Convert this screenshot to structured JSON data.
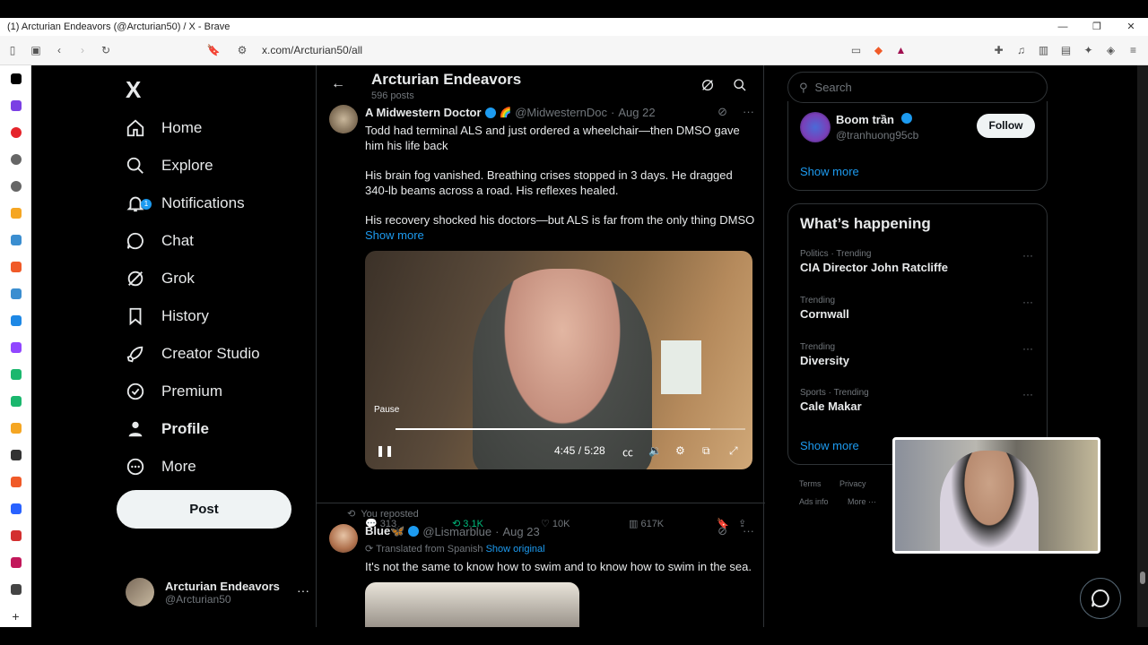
{
  "window": {
    "title": "(1) Arcturian Endeavors (@Arcturian50) / X - Brave",
    "controls": [
      "—",
      "❐",
      "✕"
    ]
  },
  "address": {
    "url": "x.com/Arcturian50/all"
  },
  "nav": {
    "logo": "X",
    "items": [
      {
        "label": "Home",
        "icon": "home-icon"
      },
      {
        "label": "Explore",
        "icon": "search-icon"
      },
      {
        "label": "Notifications",
        "icon": "bell-icon",
        "badge": "1"
      },
      {
        "label": "Chat",
        "icon": "chat-icon"
      },
      {
        "label": "Grok",
        "icon": "grok-icon"
      },
      {
        "label": "History",
        "icon": "bookmark-icon"
      },
      {
        "label": "Creator Studio",
        "icon": "rocket-icon"
      },
      {
        "label": "Premium",
        "icon": "verified-icon"
      },
      {
        "label": "Profile",
        "icon": "person-icon"
      },
      {
        "label": "More",
        "icon": "more-circle-icon"
      }
    ],
    "post_label": "Post",
    "account": {
      "name": "Arcturian Endeavors",
      "handle": "@Arcturian50"
    }
  },
  "header": {
    "title": "Arcturian Endeavors",
    "subtitle": "596 posts"
  },
  "tweet1": {
    "name": "A Midwestern Doctor",
    "handle": "@MidwesternDoc",
    "date": "Aug 22",
    "p1": "Todd had terminal ALS and just ordered a wheelchair—then DMSO gave him his life back",
    "p2": "His brain fog vanished. Breathing crises stopped in 3 days. He dragged 340-lb beams across a road. His reflexes healed.",
    "p3": "His recovery shocked his doctors—but ALS is far from the only thing DMSO",
    "show_more": "Show more",
    "video": {
      "tooltip": "Pause",
      "time": "4:45 / 5:28",
      "progress": 0.9
    },
    "replies": "313",
    "reposts": "3.1K",
    "likes": "10K",
    "views": "617K"
  },
  "tweet2": {
    "reposted": "You reposted",
    "name": "Blue🦋",
    "handle": "@Lismarblue",
    "date": "Aug 23",
    "translated": "Translated from Spanish",
    "show_original": "Show original",
    "text": "It's not the same to know how to swim and to know how to swim in the sea."
  },
  "right": {
    "search_placeholder": "Search",
    "suggest": {
      "name": "Boom trần",
      "handle": "@tranhuong95cb",
      "follow": "Follow",
      "show_more": "Show more"
    },
    "happening_title": "What’s happening",
    "trends": [
      {
        "cat": "Politics · Trending",
        "topic": "CIA Director John Ratcliffe"
      },
      {
        "cat": "Trending",
        "topic": "Cornwall"
      },
      {
        "cat": "Trending",
        "topic": "Diversity"
      },
      {
        "cat": "Sports · Trending",
        "topic": "Cale Makar"
      }
    ],
    "show_more": "Show more",
    "footer": [
      "Terms",
      "Privacy",
      "Ads info",
      "More ···"
    ]
  },
  "colors": {
    "accent": "#1d9bf0",
    "repost": "#00ba7c",
    "bg": "#000000"
  }
}
